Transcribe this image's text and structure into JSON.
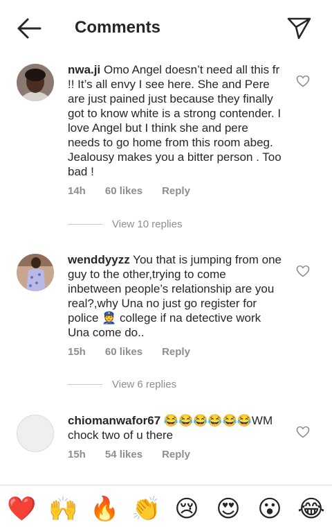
{
  "header": {
    "title": "Comments"
  },
  "comments": [
    {
      "username": "nwa.ji",
      "text": "Omo Angel doesn’t need all this fr !! It’s all envy I see here. She and Pere are just pained just because they finally got to know white is a strong contender. I love Angel but I think she and pere needs to go home from this room abeg. Jealousy makes you a bitter person . Too bad !",
      "time": "14h",
      "likes": "60 likes",
      "reply": "Reply",
      "view_replies": "View 10 replies"
    },
    {
      "username": "wenddyyzz",
      "text": "You that is jumping from one guy to the other,trying to come inbetween people’s relationship are you real?,why Una no just go register for police 👮 college if na detective work Una come do..",
      "time": "15h",
      "likes": "60 likes",
      "reply": "Reply",
      "view_replies": "View 6 replies"
    },
    {
      "username": "chiomanwafor67",
      "text": "😂😂😂😂😂😂WM chock two of u there",
      "time": "15h",
      "likes": "54 likes",
      "reply": "Reply"
    }
  ],
  "emoji_bar": [
    "❤️",
    "🙌",
    "🔥",
    "👏",
    "😢",
    "😍",
    "😮",
    "😂"
  ],
  "icons": {
    "back": "arrow-left-icon",
    "send": "paper-plane-icon",
    "like": "heart-outline-icon"
  }
}
